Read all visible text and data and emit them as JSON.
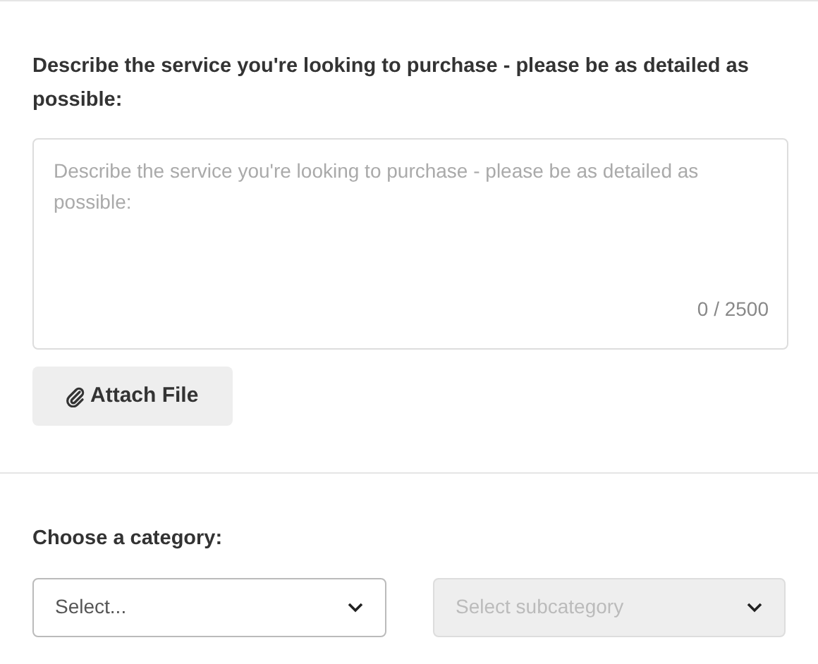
{
  "description": {
    "label": "Describe the service you're looking to purchase - please be as detailed as possible:",
    "placeholder": "Describe the service you're looking to purchase - please be as detailed as possible:",
    "counter": "0 / 2500"
  },
  "attach_button": {
    "label": "Attach File"
  },
  "category": {
    "label": "Choose a category:",
    "selects": [
      {
        "placeholder": "Select...",
        "disabled": false
      },
      {
        "placeholder": "Select subcategory",
        "disabled": true
      }
    ]
  }
}
